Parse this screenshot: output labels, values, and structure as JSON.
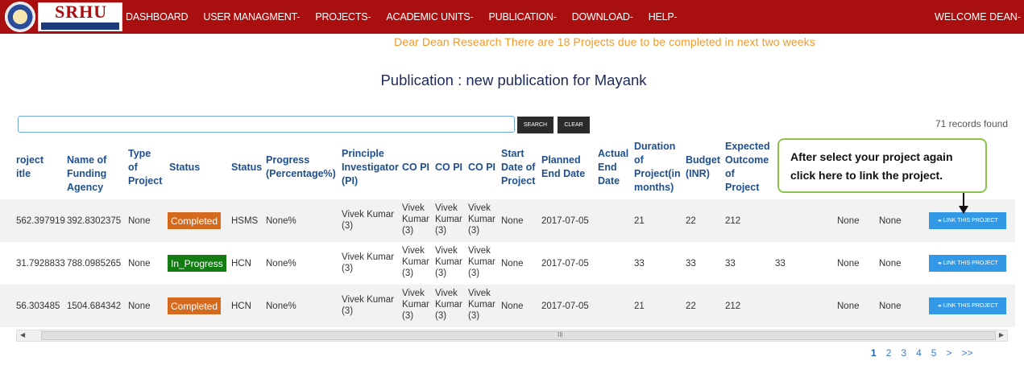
{
  "navbar": {
    "logo_text": "SRHU",
    "items": [
      "DASHBOARD",
      "USER MANAGMENT",
      "PROJECTS",
      "ACADEMIC UNITS",
      "PUBLICATION",
      "DOWNLOAD",
      "HELP"
    ],
    "dropdown_marker": "-",
    "welcome": "WELCOME DEAN",
    "bg_color": "#a90f0f"
  },
  "alert": "Dear Dean Research There are 18 Projects due to be completed in next two weeks",
  "page_title": "Publication : new publication for Mayank",
  "search": {
    "value": "",
    "search_label": "SEARCH",
    "clear_label": "CLEAR"
  },
  "records_found": "71 records found",
  "table": {
    "headers": {
      "project_title": [
        "roject",
        "itle"
      ],
      "funding": [
        "Name of",
        "Funding",
        "Agency"
      ],
      "type": [
        "Type",
        "of",
        "Project"
      ],
      "status": "Status",
      "status2": "Status",
      "progress": [
        "Progress",
        "(Percentage%)"
      ],
      "pi": [
        "Principle",
        "Investigator",
        "(PI)"
      ],
      "copi1": "CO PI",
      "copi2": "CO PI",
      "copi3": "CO PI",
      "start": [
        "Start",
        "Date of",
        "Project"
      ],
      "planned": [
        "Planned",
        "End Date"
      ],
      "actual": [
        "Actual",
        "End",
        "Date"
      ],
      "duration": [
        "Duration",
        "of",
        "Project(in",
        "months)"
      ],
      "budget": [
        "Budget",
        "(INR)"
      ],
      "outcome": [
        "Expected",
        "Outcome",
        "of",
        "Project"
      ]
    },
    "rows": [
      {
        "project_title": "562.397919",
        "funding": "392.8302375",
        "type": "None",
        "status": "Completed",
        "status_kind": "completed",
        "status2": "HSMS",
        "progress": "None%",
        "pi": [
          "Vivek Kumar",
          "(3)"
        ],
        "copi": [
          "Vivek",
          "Kumar",
          "(3)"
        ],
        "start": "None",
        "planned": "2017-07-05",
        "actual": "",
        "duration": "21",
        "budget": "22",
        "outcome": "212",
        "extra": "",
        "col_a": "None",
        "col_b": "None",
        "link_label": "LINK THIS PROJECT"
      },
      {
        "project_title": "31.7928833",
        "funding": "788.0985265",
        "type": "None",
        "status": "In_Progress",
        "status_kind": "in_progress",
        "status2": "HCN",
        "progress": "None%",
        "pi": [
          "Vivek Kumar",
          "(3)"
        ],
        "copi": [
          "Vivek",
          "Kumar",
          "(3)"
        ],
        "start": "None",
        "planned": "2017-07-05",
        "actual": "",
        "duration": "33",
        "budget": "33",
        "outcome": "33",
        "extra": "33",
        "col_a": "None",
        "col_b": "None",
        "link_label": "LINK THIS PROJECT"
      },
      {
        "project_title": "56.303485",
        "funding": "1504.684342",
        "type": "None",
        "status": "Completed",
        "status_kind": "completed",
        "status2": "HCN",
        "progress": "None%",
        "pi": [
          "Vivek Kumar",
          "(3)"
        ],
        "copi": [
          "Vivek",
          "Kumar",
          "(3)"
        ],
        "start": "None",
        "planned": "2017-07-05",
        "actual": "",
        "duration": "21",
        "budget": "22",
        "outcome": "212",
        "extra": "",
        "col_a": "None",
        "col_b": "None",
        "link_label": "LINK THIS PROJECT"
      }
    ]
  },
  "callout": "After select your project again click here to link the project.",
  "scrollbar_grip": "III",
  "pagination": [
    "1",
    "2",
    "3",
    "4",
    "5",
    ">",
    ">>"
  ],
  "colors": {
    "completed": "#d5691e",
    "in_progress": "#137d13",
    "link_button": "#3399e6",
    "alert_text": "#f39a2b",
    "callout_border": "#8bc34a"
  }
}
